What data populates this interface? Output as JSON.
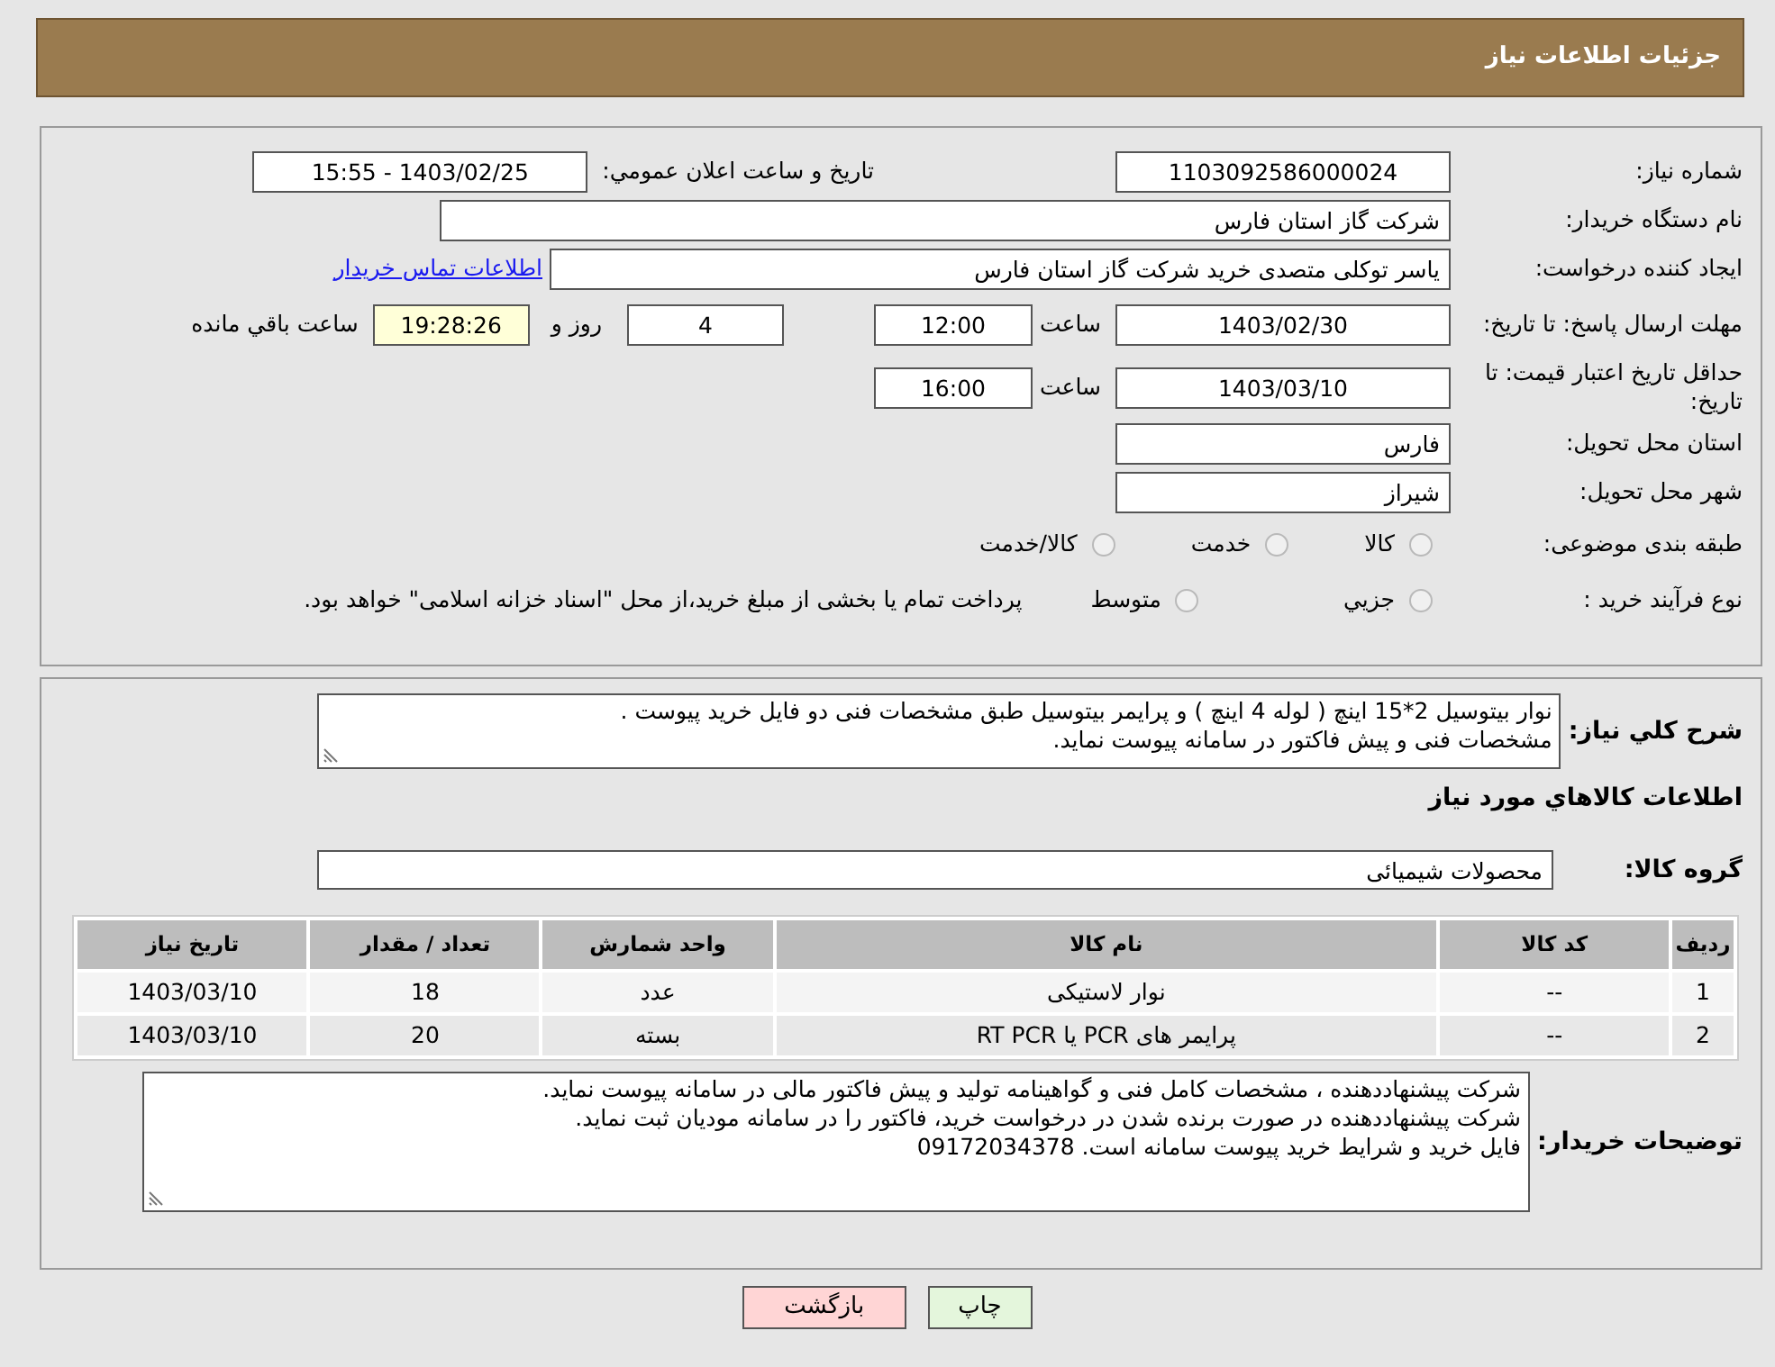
{
  "header": {
    "title": "جزئیات اطلاعات نیاز"
  },
  "need_number": {
    "label": "شماره نیاز:",
    "value": "1103092586000024"
  },
  "announce": {
    "label": "تاریخ و ساعت اعلان عمومي:",
    "value": "1403/02/25 - 15:55"
  },
  "buyer_org": {
    "label": "نام دستگاه خریدار:",
    "value": "شرکت گاز استان فارس"
  },
  "requester": {
    "label": "ایجاد کننده درخواست:",
    "value": "یاسر توکلی متصدی خرید شرکت گاز استان فارس",
    "link": "اطلاعات تماس خریدار"
  },
  "deadline": {
    "label": "مهلت ارسال پاسخ: تا تاریخ:",
    "date": "1403/02/30",
    "time_label": "ساعت",
    "time": "12:00",
    "days": "4",
    "days_label": "روز و",
    "remaining": "19:28:26",
    "remaining_label": "ساعت باقي مانده"
  },
  "validity": {
    "label": "حداقل تاریخ اعتبار قیمت: تا تاریخ:",
    "date": "1403/03/10",
    "time_label": "ساعت",
    "time": "16:00"
  },
  "province": {
    "label": "استان محل تحویل:",
    "value": "فارس"
  },
  "city": {
    "label": "شهر محل تحویل:",
    "value": "شیراز"
  },
  "category": {
    "label": "طبقه بندی موضوعی:",
    "options": [
      {
        "label": "کالا",
        "selected": false
      },
      {
        "label": "خدمت",
        "selected": false
      },
      {
        "label": "کالا/خدمت",
        "selected": false
      }
    ]
  },
  "purchase_type": {
    "label": "نوع فرآیند خرید :",
    "options": [
      {
        "label": "جزيي",
        "selected": false
      },
      {
        "label": "متوسط",
        "selected": false
      }
    ],
    "note": "پرداخت تمام یا بخشی از مبلغ خرید،از محل \"اسناد خزانه اسلامی\" خواهد بود."
  },
  "description": {
    "label": "شرح کلي نیاز:",
    "lines": [
      "نوار بیتوسیل 2*15 اینچ ( لوله 4 اینچ ) و پرایمر بیتوسیل طبق مشخصات فنی دو فایل خرید پیوست .",
      "مشخصات فنی و پیش فاکتور در سامانه پیوست نماید."
    ]
  },
  "goods_title": "اطلاعات كالاهاي مورد نياز",
  "goods_group": {
    "label": "گروه کالا:",
    "value": "محصولات شیمیائی"
  },
  "table": {
    "columns": [
      "ردیف",
      "کد کالا",
      "نام کالا",
      "واحد شمارش",
      "تعداد / مقدار",
      "تاریخ نیاز"
    ],
    "rows": [
      [
        "1",
        "--",
        "نوار لاستیکی",
        "عدد",
        "18",
        "1403/03/10"
      ],
      [
        "2",
        "--",
        "پرایمر های PCR یا RT PCR",
        "بسته",
        "20",
        "1403/03/10"
      ]
    ]
  },
  "buyer_notes": {
    "label": "توضیحات خریدار:",
    "lines": [
      "شرکت پیشنهاددهنده ، مشخصات کامل فنی و گواهینامه تولید و پیش فاکتور مالی در سامانه پیوست نماید.",
      "شرکت پیشنهاددهنده در صورت برنده شدن در درخواست خرید، فاکتور را در سامانه مودیان ثبت نماید.",
      "فایل خرید و شرایط خرید پیوست سامانه است. 09172034378"
    ]
  },
  "buttons": [
    {
      "kind": "print",
      "label": "چاپ"
    },
    {
      "kind": "back",
      "label": "بازگشت"
    }
  ]
}
